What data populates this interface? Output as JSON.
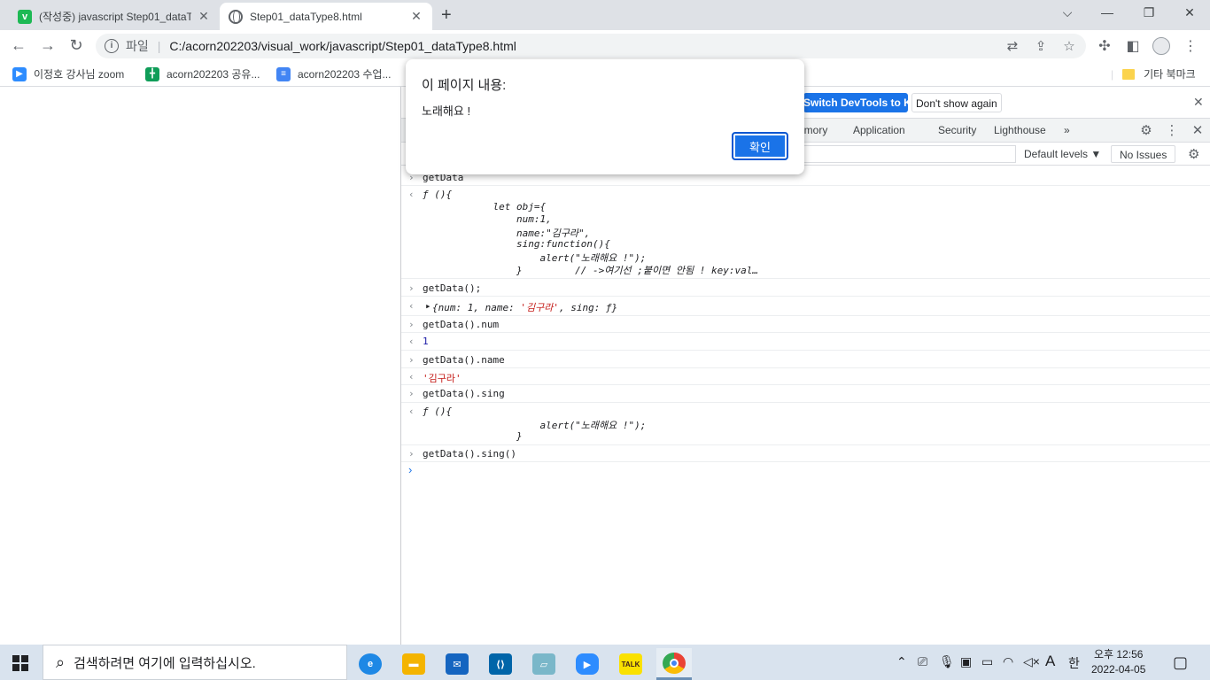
{
  "tabs": [
    {
      "title": "(작성중) javascript Step01_dataT",
      "close": "✕"
    },
    {
      "title": "Step01_dataType8.html",
      "close": "✕"
    }
  ],
  "address": {
    "scheme": "파일",
    "sep": "|",
    "url": "C:/acorn202203/visual_work/javascript/Step01_dataType8.html"
  },
  "bookmarks": [
    {
      "label": "이정호 강사님 zoom",
      "color": "#2d8cff"
    },
    {
      "label": "acorn202203 공유...",
      "color": "#0f9d58"
    },
    {
      "label": "acorn202203 수업...",
      "color": "#4285f4"
    }
  ],
  "other_bookmarks": "기타 북마크",
  "devtools": {
    "lang_button": "Switch DevTools to Korean",
    "dont_show": "Don't show again",
    "tabs": [
      "emory",
      "Application",
      "Security",
      "Lighthouse"
    ],
    "more": "»",
    "levels": "Default levels ▼",
    "issues": "No Issues"
  },
  "console": {
    "e1_input": "getData",
    "e1_out": "ƒ (){",
    "e1_code": [
      "            let obj={",
      "                num:1,",
      "                name:\"김구라\",",
      "                sing:function(){",
      "                    alert(\"노래해요 !\");",
      "                }         // ->여기선 ;붙이면 안됨 ! key:val…"
    ],
    "e2_input": "getData();",
    "e2_out_a": "{num: 1, name: ",
    "e2_out_str": "'김구라'",
    "e2_out_b": ", sing: ƒ}",
    "e3_input": "getData().num",
    "e3_out": "1",
    "e4_input": "getData().name",
    "e4_out": "'김구라'",
    "e5_input": "getData().sing",
    "e5_out": "ƒ (){",
    "e5_code": [
      "                    alert(\"노래해요 !\");",
      "                }"
    ],
    "e6_input": "getData().sing()"
  },
  "alert": {
    "title": "이 페이지 내용:",
    "message": "노래해요 !",
    "ok": "확인"
  },
  "taskbar": {
    "search_placeholder": "검색하려면 여기에 입력하십시오.",
    "time": "오후 12:56",
    "date": "2022-04-05",
    "ime": "A",
    "lang": "한"
  }
}
